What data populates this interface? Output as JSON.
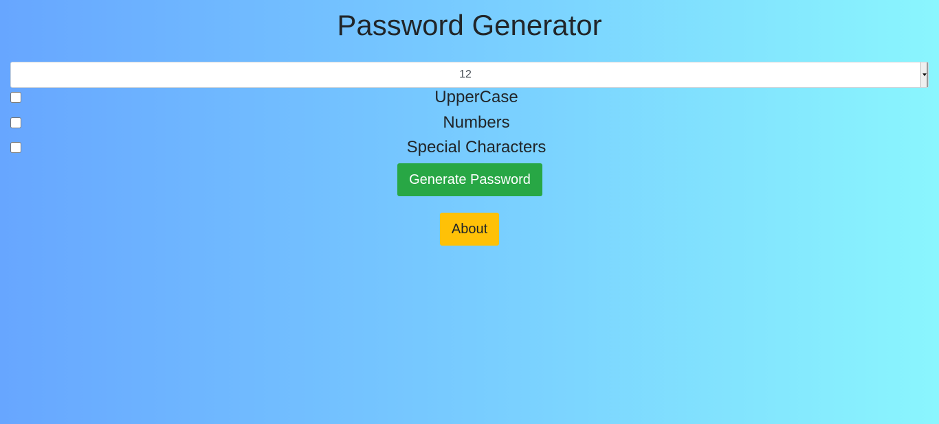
{
  "page": {
    "title": "Password Generator"
  },
  "length_select": {
    "selected_value": "12"
  },
  "options": [
    {
      "label": "UpperCase",
      "checked": false
    },
    {
      "label": "Numbers",
      "checked": false
    },
    {
      "label": "Special Characters",
      "checked": false
    }
  ],
  "buttons": {
    "generate_label": "Generate Password",
    "about_label": "About"
  },
  "colors": {
    "background_start": "#67a6ff",
    "background_end": "#8af6fe",
    "generate_button": "#28a745",
    "about_button": "#ffc107"
  }
}
